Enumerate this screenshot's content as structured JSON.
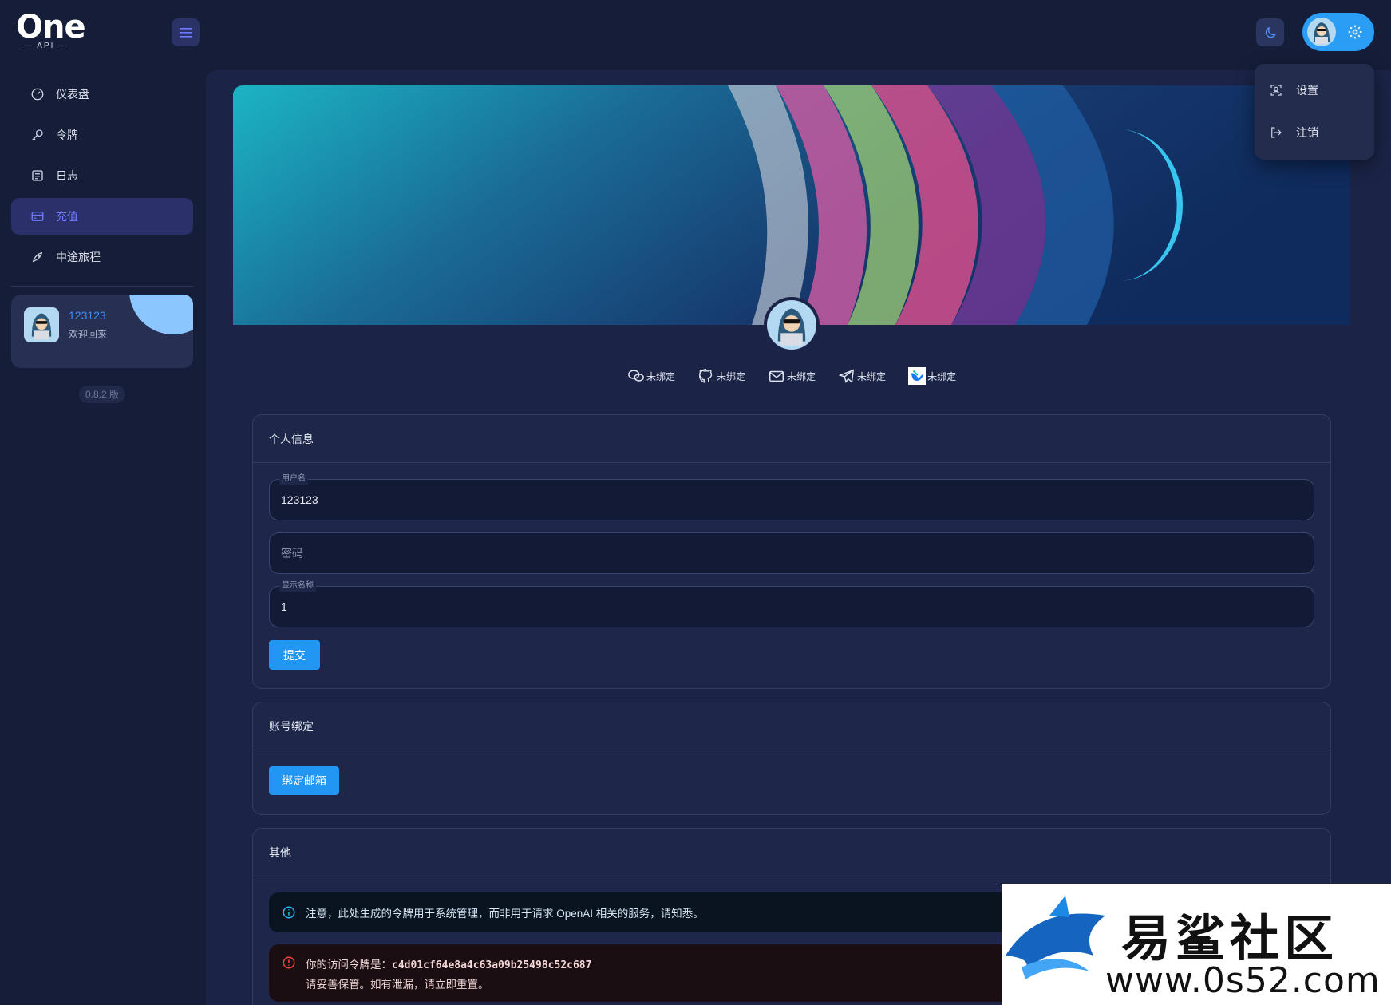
{
  "app": {
    "logo_text": "One",
    "logo_subtitle": "— API —"
  },
  "sidebar": {
    "items": [
      {
        "label": "仪表盘",
        "icon": "dashboard-icon",
        "active": false
      },
      {
        "label": "令牌",
        "icon": "key-icon",
        "active": false
      },
      {
        "label": "日志",
        "icon": "log-icon",
        "active": false
      },
      {
        "label": "充值",
        "icon": "credit-card-icon",
        "active": true
      },
      {
        "label": "中途旅程",
        "icon": "rocket-icon",
        "active": false
      }
    ],
    "user_card": {
      "username": "123123",
      "welcome": "欢迎回来"
    },
    "version": "0.8.2 版"
  },
  "dropdown": {
    "items": [
      {
        "label": "设置",
        "icon": "user-settings-icon"
      },
      {
        "label": "注销",
        "icon": "logout-icon"
      }
    ]
  },
  "bindings": [
    {
      "label": "未绑定",
      "icon": "wechat-icon"
    },
    {
      "label": "未绑定",
      "icon": "github-icon"
    },
    {
      "label": "未绑定",
      "icon": "mail-icon"
    },
    {
      "label": "未绑定",
      "icon": "telegram-icon"
    },
    {
      "label": "未绑定",
      "icon": "lark-icon"
    }
  ],
  "personal": {
    "title": "个人信息",
    "username_label": "用户名",
    "username_value": "123123",
    "password_placeholder": "密码",
    "display_label": "显示名称",
    "display_value": "1",
    "submit_label": "提交"
  },
  "account_binding": {
    "title": "账号绑定",
    "bind_email_label": "绑定邮箱"
  },
  "other": {
    "title": "其他",
    "info_text": "注意，此处生成的令牌用于系统管理，而非用于请求 OpenAI 相关的服务，请知悉。",
    "token_prefix": "你的访问令牌是：",
    "token_value": "c4d01cf64e8a4c63a09b25498c52c687",
    "token_warning": "请妥善保管。如有泄漏，请立即重置。"
  },
  "watermark": {
    "name": "易鲨社区",
    "url": "www.0s52.com"
  },
  "colors": {
    "accent": "#2196f3",
    "active_nav": "#6f7cff",
    "background": "#151d38"
  }
}
